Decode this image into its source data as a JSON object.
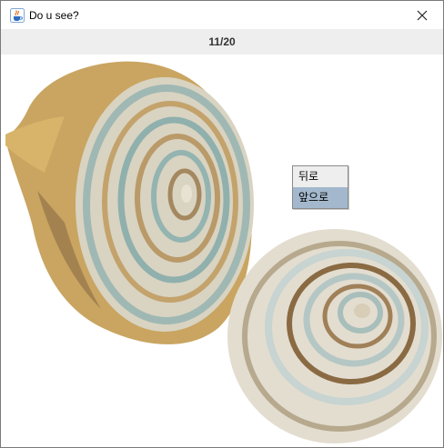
{
  "window": {
    "title": "Do u see?",
    "app_icon": "java-cup-icon",
    "close_icon": "close-icon"
  },
  "status": {
    "counter": "11/20"
  },
  "image": {
    "subject": "sliced-snail-shell-photo"
  },
  "context_menu": {
    "items": [
      {
        "label": "뒤로",
        "selected": false
      },
      {
        "label": "앞으로",
        "selected": true
      }
    ],
    "selected_color": "#a3b8cc"
  }
}
